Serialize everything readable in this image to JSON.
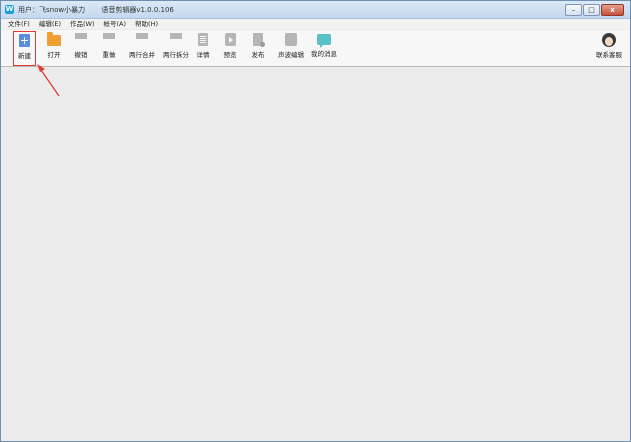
{
  "window": {
    "title_user": "用户：飞snow小暴力",
    "title_app": "语音剪辑器v1.0.0.106",
    "app_icon": "W",
    "controls": {
      "minimize": "–",
      "maximize": "□",
      "close": "x"
    }
  },
  "menu": [
    "文件(F)",
    "编辑(E)",
    "作品(W)",
    "帐号(A)",
    "帮助(H)"
  ],
  "toolbar": {
    "new": "新建",
    "open": "打开",
    "undo": "撤销",
    "redo": "重做",
    "merge_lines": "两行合并",
    "split_lines": "两行拆分",
    "details": "详情",
    "preview": "预览",
    "publish": "发布",
    "waveform": "声波编辑",
    "messages": "我的消息",
    "support": "联系客服"
  },
  "colors": {
    "highlight": "#e53935",
    "accent": "#5b8dd9"
  }
}
